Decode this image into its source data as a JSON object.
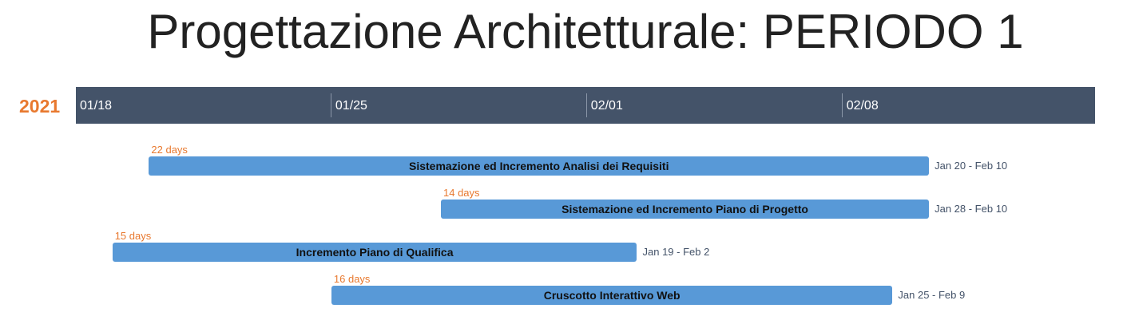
{
  "chart_data": {
    "type": "gantt",
    "title": "Progettazione Architetturale: PERIODO 1",
    "year": "2021",
    "x_ticks": [
      {
        "label": "01/18",
        "date": "2021-01-18"
      },
      {
        "label": "01/25",
        "date": "2021-01-25"
      },
      {
        "label": "02/01",
        "date": "2021-02-01"
      },
      {
        "label": "02/08",
        "date": "2021-02-08"
      }
    ],
    "x_range": [
      "2021-01-18",
      "2021-02-15"
    ],
    "tasks": [
      {
        "name": "Sistemazione ed Incremento Analisi dei Requisiti",
        "start": "2021-01-20",
        "end": "2021-02-10",
        "duration": "22 days",
        "range_label": "Jan 20 - Feb 10"
      },
      {
        "name": "Sistemazione ed Incremento Piano di Progetto",
        "start": "2021-01-28",
        "end": "2021-02-10",
        "duration": "14 days",
        "range_label": "Jan 28 - Feb 10"
      },
      {
        "name": "Incremento Piano di Qualifica",
        "start": "2021-01-19",
        "end": "2021-02-02",
        "duration": "15 days",
        "range_label": "Jan 19 - Feb 2"
      },
      {
        "name": "Cruscotto Interattivo Web",
        "start": "2021-01-25",
        "end": "2021-02-09",
        "duration": "16 days",
        "range_label": "Jan 25 - Feb 9"
      }
    ],
    "colors": {
      "bar": "#5899d7",
      "axis_band": "#445369",
      "accent": "#e8792f"
    }
  }
}
